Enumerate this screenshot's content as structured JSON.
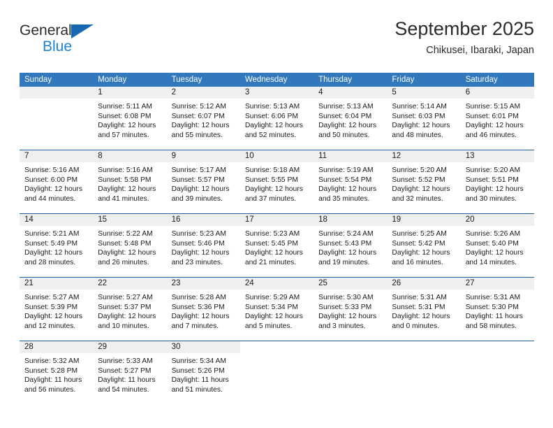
{
  "brand": {
    "name_dark": "General",
    "name_blue": "Blue",
    "accent_blue": "#1b82d2",
    "triangle_blue": "#1668b3"
  },
  "header": {
    "title": "September 2025",
    "subtitle": "Chikusei, Ibaraki, Japan"
  },
  "calendar": {
    "header_bg": "#3178bd",
    "daynum_bg": "#efefef",
    "row_divider": "#1c5ea0",
    "weekdays": [
      "Sunday",
      "Monday",
      "Tuesday",
      "Wednesday",
      "Thursday",
      "Friday",
      "Saturday"
    ],
    "weeks": [
      [
        {
          "day": "",
          "lines": []
        },
        {
          "day": "1",
          "lines": [
            "Sunrise: 5:11 AM",
            "Sunset: 6:08 PM",
            "Daylight: 12 hours",
            "and 57 minutes."
          ]
        },
        {
          "day": "2",
          "lines": [
            "Sunrise: 5:12 AM",
            "Sunset: 6:07 PM",
            "Daylight: 12 hours",
            "and 55 minutes."
          ]
        },
        {
          "day": "3",
          "lines": [
            "Sunrise: 5:13 AM",
            "Sunset: 6:06 PM",
            "Daylight: 12 hours",
            "and 52 minutes."
          ]
        },
        {
          "day": "4",
          "lines": [
            "Sunrise: 5:13 AM",
            "Sunset: 6:04 PM",
            "Daylight: 12 hours",
            "and 50 minutes."
          ]
        },
        {
          "day": "5",
          "lines": [
            "Sunrise: 5:14 AM",
            "Sunset: 6:03 PM",
            "Daylight: 12 hours",
            "and 48 minutes."
          ]
        },
        {
          "day": "6",
          "lines": [
            "Sunrise: 5:15 AM",
            "Sunset: 6:01 PM",
            "Daylight: 12 hours",
            "and 46 minutes."
          ]
        }
      ],
      [
        {
          "day": "7",
          "lines": [
            "Sunrise: 5:16 AM",
            "Sunset: 6:00 PM",
            "Daylight: 12 hours",
            "and 44 minutes."
          ]
        },
        {
          "day": "8",
          "lines": [
            "Sunrise: 5:16 AM",
            "Sunset: 5:58 PM",
            "Daylight: 12 hours",
            "and 41 minutes."
          ]
        },
        {
          "day": "9",
          "lines": [
            "Sunrise: 5:17 AM",
            "Sunset: 5:57 PM",
            "Daylight: 12 hours",
            "and 39 minutes."
          ]
        },
        {
          "day": "10",
          "lines": [
            "Sunrise: 5:18 AM",
            "Sunset: 5:55 PM",
            "Daylight: 12 hours",
            "and 37 minutes."
          ]
        },
        {
          "day": "11",
          "lines": [
            "Sunrise: 5:19 AM",
            "Sunset: 5:54 PM",
            "Daylight: 12 hours",
            "and 35 minutes."
          ]
        },
        {
          "day": "12",
          "lines": [
            "Sunrise: 5:20 AM",
            "Sunset: 5:52 PM",
            "Daylight: 12 hours",
            "and 32 minutes."
          ]
        },
        {
          "day": "13",
          "lines": [
            "Sunrise: 5:20 AM",
            "Sunset: 5:51 PM",
            "Daylight: 12 hours",
            "and 30 minutes."
          ]
        }
      ],
      [
        {
          "day": "14",
          "lines": [
            "Sunrise: 5:21 AM",
            "Sunset: 5:49 PM",
            "Daylight: 12 hours",
            "and 28 minutes."
          ]
        },
        {
          "day": "15",
          "lines": [
            "Sunrise: 5:22 AM",
            "Sunset: 5:48 PM",
            "Daylight: 12 hours",
            "and 26 minutes."
          ]
        },
        {
          "day": "16",
          "lines": [
            "Sunrise: 5:23 AM",
            "Sunset: 5:46 PM",
            "Daylight: 12 hours",
            "and 23 minutes."
          ]
        },
        {
          "day": "17",
          "lines": [
            "Sunrise: 5:23 AM",
            "Sunset: 5:45 PM",
            "Daylight: 12 hours",
            "and 21 minutes."
          ]
        },
        {
          "day": "18",
          "lines": [
            "Sunrise: 5:24 AM",
            "Sunset: 5:43 PM",
            "Daylight: 12 hours",
            "and 19 minutes."
          ]
        },
        {
          "day": "19",
          "lines": [
            "Sunrise: 5:25 AM",
            "Sunset: 5:42 PM",
            "Daylight: 12 hours",
            "and 16 minutes."
          ]
        },
        {
          "day": "20",
          "lines": [
            "Sunrise: 5:26 AM",
            "Sunset: 5:40 PM",
            "Daylight: 12 hours",
            "and 14 minutes."
          ]
        }
      ],
      [
        {
          "day": "21",
          "lines": [
            "Sunrise: 5:27 AM",
            "Sunset: 5:39 PM",
            "Daylight: 12 hours",
            "and 12 minutes."
          ]
        },
        {
          "day": "22",
          "lines": [
            "Sunrise: 5:27 AM",
            "Sunset: 5:37 PM",
            "Daylight: 12 hours",
            "and 10 minutes."
          ]
        },
        {
          "day": "23",
          "lines": [
            "Sunrise: 5:28 AM",
            "Sunset: 5:36 PM",
            "Daylight: 12 hours",
            "and 7 minutes."
          ]
        },
        {
          "day": "24",
          "lines": [
            "Sunrise: 5:29 AM",
            "Sunset: 5:34 PM",
            "Daylight: 12 hours",
            "and 5 minutes."
          ]
        },
        {
          "day": "25",
          "lines": [
            "Sunrise: 5:30 AM",
            "Sunset: 5:33 PM",
            "Daylight: 12 hours",
            "and 3 minutes."
          ]
        },
        {
          "day": "26",
          "lines": [
            "Sunrise: 5:31 AM",
            "Sunset: 5:31 PM",
            "Daylight: 12 hours",
            "and 0 minutes."
          ]
        },
        {
          "day": "27",
          "lines": [
            "Sunrise: 5:31 AM",
            "Sunset: 5:30 PM",
            "Daylight: 11 hours",
            "and 58 minutes."
          ]
        }
      ],
      [
        {
          "day": "28",
          "lines": [
            "Sunrise: 5:32 AM",
            "Sunset: 5:28 PM",
            "Daylight: 11 hours",
            "and 56 minutes."
          ]
        },
        {
          "day": "29",
          "lines": [
            "Sunrise: 5:33 AM",
            "Sunset: 5:27 PM",
            "Daylight: 11 hours",
            "and 54 minutes."
          ]
        },
        {
          "day": "30",
          "lines": [
            "Sunrise: 5:34 AM",
            "Sunset: 5:26 PM",
            "Daylight: 11 hours",
            "and 51 minutes."
          ]
        },
        {
          "day": "",
          "lines": []
        },
        {
          "day": "",
          "lines": []
        },
        {
          "day": "",
          "lines": []
        },
        {
          "day": "",
          "lines": []
        }
      ]
    ]
  }
}
